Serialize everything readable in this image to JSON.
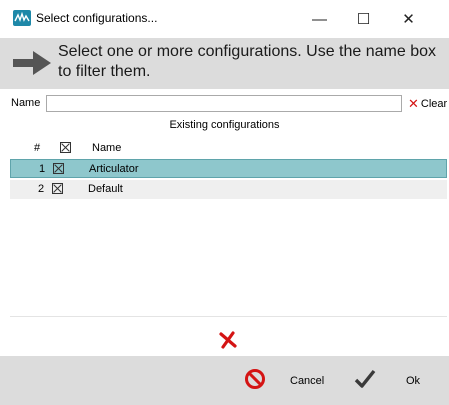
{
  "window": {
    "title": "Select configurations...",
    "minimize_glyph": "—",
    "maximize_glyph": "☐",
    "close_glyph": "✕"
  },
  "header": {
    "instruction": "Select one or more configurations. Use the name box to filter them."
  },
  "filter": {
    "label": "Name",
    "value": "",
    "placeholder": "",
    "clear_label": "Clear",
    "clear_glyph": "✕"
  },
  "table": {
    "section_title": "Existing configurations",
    "columns": {
      "number": "#",
      "name": "Name"
    },
    "rows": [
      {
        "number": "1",
        "name": "Articulator",
        "checked": true,
        "selected": true
      },
      {
        "number": "2",
        "name": "Default",
        "checked": true,
        "selected": false
      }
    ]
  },
  "footer": {
    "cancel_label": "Cancel",
    "ok_label": "Ok"
  },
  "colors": {
    "selection": "#8ec7cc",
    "header_bg": "#dcdcdc",
    "danger": "#d41414"
  }
}
